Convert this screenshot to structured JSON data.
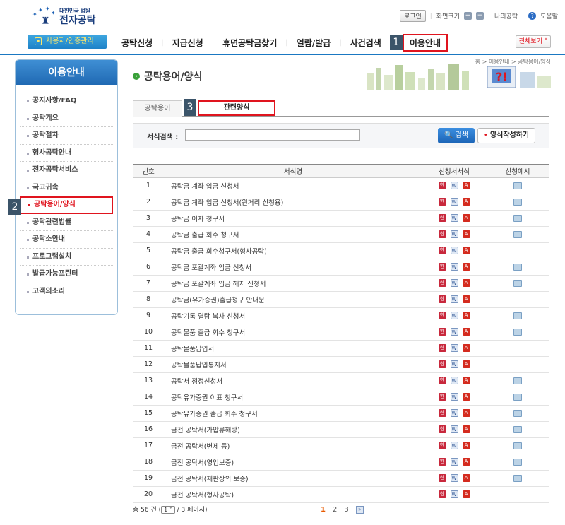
{
  "header": {
    "logo_sub": "대한민국 법원",
    "logo_main": "전자공탁",
    "login": "로그인",
    "font_size": "화면크기",
    "my_deposit": "나의공탁",
    "help": "도움말"
  },
  "nav": {
    "user_btn": "사용자/인증관리",
    "items": [
      "공탁신청",
      "지급신청",
      "휴면공탁금찾기",
      "열람/발급",
      "사건검색",
      "이용안내"
    ],
    "all_view": "전체보기",
    "badge1": "1"
  },
  "breadcrumb": "홈 > 이용안내 > 공탁용어/양식",
  "sidebar": {
    "title": "이용안내",
    "items": [
      "공지사항/FAQ",
      "공탁개요",
      "공탁절차",
      "형사공탁안내",
      "전자공탁서비스",
      "국고귀속",
      "공탁용어/양식",
      "공탁관련법률",
      "공탁소안내",
      "프로그램설치",
      "발급가능프린터",
      "고객의소리"
    ],
    "badge2": "2"
  },
  "page_title": "공탁용어/양식",
  "tabs": {
    "tab1": "공탁용어",
    "tab2": "관련양식",
    "badge3": "3"
  },
  "search": {
    "label": "서식검색 :",
    "value": "",
    "button": "검색",
    "write_button": "양식작성하기"
  },
  "table": {
    "headers": [
      "번호",
      "서식명",
      "신청서서식",
      "신청예시"
    ],
    "rows": [
      {
        "no": "1",
        "name": "공탁금 계좌 입금 신청서",
        "ex": true
      },
      {
        "no": "2",
        "name": "공탁금 계좌 입금 신청서(원거리 신청용)",
        "ex": true
      },
      {
        "no": "3",
        "name": "공탁금 이자 청구서",
        "ex": true
      },
      {
        "no": "4",
        "name": "공탁금 출급 회수 청구서",
        "ex": true
      },
      {
        "no": "5",
        "name": "공탁금 출급 회수청구서(형사공탁)",
        "ex": false
      },
      {
        "no": "6",
        "name": "공탁금 포괄계좌 입금 신청서",
        "ex": true
      },
      {
        "no": "7",
        "name": "공탁금 포괄계좌 입금 해지 신청서",
        "ex": true
      },
      {
        "no": "8",
        "name": "공탁금(유가증권)출급청구 안내문",
        "ex": false
      },
      {
        "no": "9",
        "name": "공탁기록 열람 복사 신청서",
        "ex": true
      },
      {
        "no": "10",
        "name": "공탁물품 출급 회수 청구서",
        "ex": true
      },
      {
        "no": "11",
        "name": "공탁물품납입서",
        "ex": false
      },
      {
        "no": "12",
        "name": "공탁물품납입통지서",
        "ex": false
      },
      {
        "no": "13",
        "name": "공탁서 정정신청서",
        "ex": true
      },
      {
        "no": "14",
        "name": "공탁유가증권 이표 청구서",
        "ex": true
      },
      {
        "no": "15",
        "name": "공탁유가증권 출급 회수 청구서",
        "ex": true
      },
      {
        "no": "16",
        "name": "금전 공탁서(가압류해방)",
        "ex": true
      },
      {
        "no": "17",
        "name": "금전 공탁서(변제 등)",
        "ex": true
      },
      {
        "no": "18",
        "name": "금전 공탁서(영업보증)",
        "ex": true
      },
      {
        "no": "19",
        "name": "금전 공탁서(재판상의 보증)",
        "ex": true
      },
      {
        "no": "20",
        "name": "금전 공탁서(형사공탁)",
        "ex": false
      }
    ]
  },
  "pager": {
    "total_prefix": "총 56 건 (",
    "page_sel": "1",
    "total_suffix": "/ 3 페이지)",
    "pages": [
      "1",
      "2",
      "3"
    ]
  },
  "colors": {
    "accent": "#1a78c2",
    "highlight": "#e0141e"
  }
}
